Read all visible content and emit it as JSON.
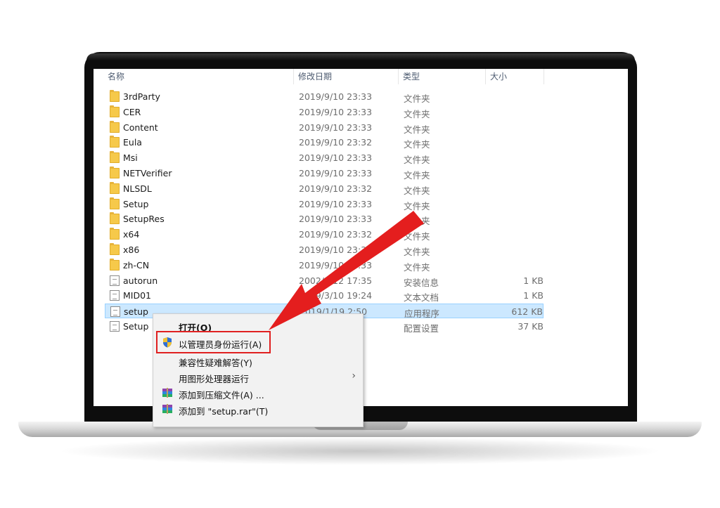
{
  "columns": {
    "name": "名称",
    "date": "修改日期",
    "type": "类型",
    "size": "大小"
  },
  "files": [
    {
      "name": "3rdParty",
      "date": "2019/9/10 23:33",
      "type": "文件夹",
      "size": "",
      "kind": "folder"
    },
    {
      "name": "CER",
      "date": "2019/9/10 23:33",
      "type": "文件夹",
      "size": "",
      "kind": "folder"
    },
    {
      "name": "Content",
      "date": "2019/9/10 23:33",
      "type": "文件夹",
      "size": "",
      "kind": "folder"
    },
    {
      "name": "Eula",
      "date": "2019/9/10 23:32",
      "type": "文件夹",
      "size": "",
      "kind": "folder"
    },
    {
      "name": "Msi",
      "date": "2019/9/10 23:33",
      "type": "文件夹",
      "size": "",
      "kind": "folder"
    },
    {
      "name": "NETVerifier",
      "date": "2019/9/10 23:33",
      "type": "文件夹",
      "size": "",
      "kind": "folder"
    },
    {
      "name": "NLSDL",
      "date": "2019/9/10 23:32",
      "type": "文件夹",
      "size": "",
      "kind": "folder"
    },
    {
      "name": "Setup",
      "date": "2019/9/10 23:33",
      "type": "文件夹",
      "size": "",
      "kind": "folder"
    },
    {
      "name": "SetupRes",
      "date": "2019/9/10 23:33",
      "type": "文件夹",
      "size": "",
      "kind": "folder"
    },
    {
      "name": "x64",
      "date": "2019/9/10 23:32",
      "type": "文件夹",
      "size": "",
      "kind": "folder"
    },
    {
      "name": "x86",
      "date": "2019/9/10 23:32",
      "type": "文件夹",
      "size": "",
      "kind": "folder"
    },
    {
      "name": "zh-CN",
      "date": "2019/9/10 23:33",
      "type": "文件夹",
      "size": "",
      "kind": "folder"
    },
    {
      "name": "autorun",
      "date": "2002/2/12 17:35",
      "type": "安装信息",
      "size": "1 KB",
      "kind": "file"
    },
    {
      "name": "MID01",
      "date": "2019/3/10 19:24",
      "type": "文本文档",
      "size": "1 KB",
      "kind": "file"
    },
    {
      "name": "setup",
      "date": "2019/1/19 2:50",
      "type": "应用程序",
      "size": "612 KB",
      "kind": "exe"
    },
    {
      "name": "Setup",
      "date": "",
      "type": "配置设置",
      "size": "37 KB",
      "kind": "file"
    }
  ],
  "context_menu": {
    "items": [
      {
        "label": "打开(O)",
        "bold": true,
        "icon": ""
      },
      {
        "label": "以管理员身份运行(A)",
        "bold": false,
        "icon": "uac-shield-icon"
      },
      {
        "label": "兼容性疑难解答(Y)",
        "bold": false,
        "icon": ""
      },
      {
        "label": "用图形处理器运行",
        "bold": false,
        "icon": "",
        "submenu": true
      },
      {
        "label": "添加到压缩文件(A) ...",
        "bold": false,
        "icon": "archive-icon"
      },
      {
        "label": "添加到 \"setup.rar\"(T)",
        "bold": false,
        "icon": "archive-icon"
      }
    ]
  },
  "colors": {
    "highlight_box": "#e02020",
    "arrow": "#e41e1e",
    "selection": "#cce8ff"
  }
}
